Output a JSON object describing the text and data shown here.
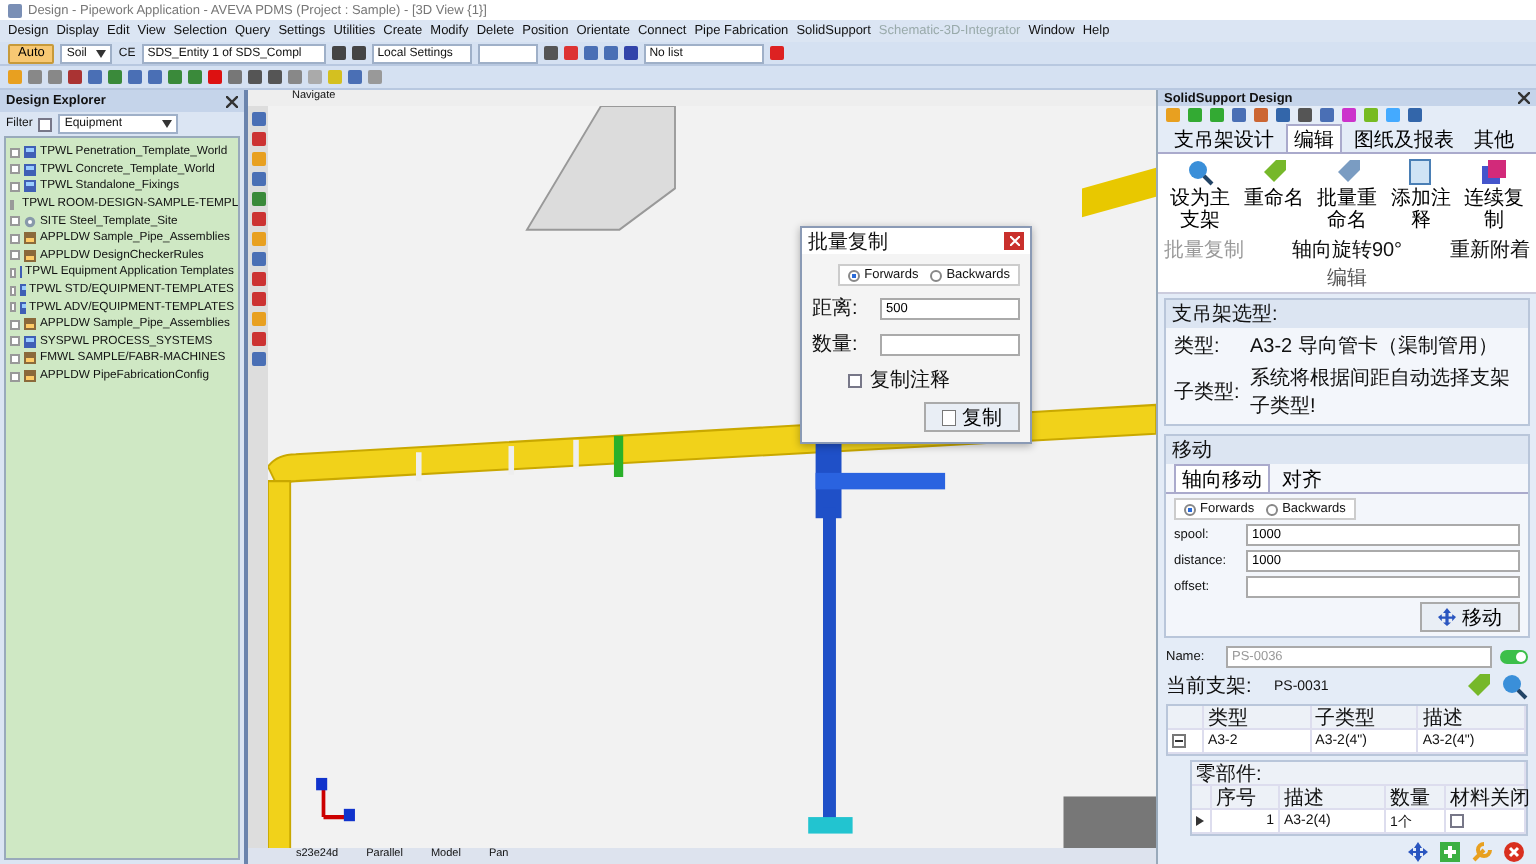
{
  "window": {
    "title": "Design - Pipework Application - AVEVA PDMS (Project : Sample) - [3D View {1}]"
  },
  "menu": [
    {
      "label": "Design",
      "disabled": false
    },
    {
      "label": "Display",
      "disabled": false
    },
    {
      "label": "Edit",
      "disabled": false
    },
    {
      "label": "View",
      "disabled": false
    },
    {
      "label": "Selection",
      "disabled": false
    },
    {
      "label": "Query",
      "disabled": false
    },
    {
      "label": "Settings",
      "disabled": false
    },
    {
      "label": "Utilities",
      "disabled": false
    },
    {
      "label": "Create",
      "disabled": false
    },
    {
      "label": "Modify",
      "disabled": false
    },
    {
      "label": "Delete",
      "disabled": false
    },
    {
      "label": "Position",
      "disabled": false
    },
    {
      "label": "Orientate",
      "disabled": false
    },
    {
      "label": "Connect",
      "disabled": false
    },
    {
      "label": "Pipe Fabrication",
      "disabled": false
    },
    {
      "label": "SolidSupport",
      "disabled": false
    },
    {
      "label": "Schematic-3D-Integrator",
      "disabled": true
    },
    {
      "label": "Window",
      "disabled": false
    },
    {
      "label": "Help",
      "disabled": false
    }
  ],
  "toolbar": {
    "mode_button": "Auto",
    "soil_select": "Soil",
    "ce_label": "CE",
    "element_select": "SDS_Entity 1 of SDS_Compl",
    "settings_select": "Local Settings",
    "list_select": "No list"
  },
  "explorer": {
    "title": "Design Explorer",
    "filter_label": "Filter",
    "filter_checked": false,
    "filter_value": "Equipment",
    "items": [
      {
        "label": "TPWL Penetration_Template_World",
        "kind": "world"
      },
      {
        "label": "TPWL Concrete_Template_World",
        "kind": "world"
      },
      {
        "label": "TPWL Standalone_Fixings",
        "kind": "world"
      },
      {
        "label": "TPWL ROOM-DESIGN-SAMPLE-TEMPL",
        "kind": "world"
      },
      {
        "label": "SITE Steel_Template_Site",
        "kind": "site"
      },
      {
        "label": "APPLDW Sample_Pipe_Assemblies",
        "kind": "app"
      },
      {
        "label": "APPLDW DesignCheckerRules",
        "kind": "app"
      },
      {
        "label": "TPWL Equipment Application Templates",
        "kind": "world"
      },
      {
        "label": "TPWL STD/EQUIPMENT-TEMPLATES",
        "kind": "world"
      },
      {
        "label": "TPWL ADV/EQUIPMENT-TEMPLATES",
        "kind": "world"
      },
      {
        "label": "APPLDW Sample_Pipe_Assemblies",
        "kind": "app"
      },
      {
        "label": "SYSPWL PROCESS_SYSTEMS",
        "kind": "world"
      },
      {
        "label": "FMWL SAMPLE/FABR-MACHINES",
        "kind": "app"
      },
      {
        "label": "APPLDW PipeFabricationConfig",
        "kind": "app"
      }
    ]
  },
  "viewport": {
    "title": "Navigate",
    "status": [
      "s23e24d",
      "Parallel",
      "Model",
      "Pan"
    ]
  },
  "dialog": {
    "title": "批量复制",
    "directions": [
      {
        "label": "Forwards",
        "selected": true
      },
      {
        "label": "Backwards",
        "selected": false
      }
    ],
    "distance_label": "距离:",
    "distance_value": "500",
    "count_label": "数量:",
    "copy_notes": {
      "label": "复制注释",
      "checked": false
    },
    "copy_button": "复制"
  },
  "support_panel": {
    "title": "SolidSupport Design",
    "tabs": [
      {
        "label": "支吊架设计",
        "selected": false
      },
      {
        "label": "编辑",
        "selected": true
      },
      {
        "label": "图纸及报表",
        "selected": false
      },
      {
        "label": "其他",
        "selected": false
      }
    ],
    "ribbon_buttons": [
      {
        "label": "设为主支架",
        "kind": "search"
      },
      {
        "label": "重命名",
        "kind": "tag"
      },
      {
        "label": "批量重命名",
        "kind": "tags"
      },
      {
        "label": "添加注释",
        "kind": "note"
      },
      {
        "label": "连续复制",
        "kind": "copy"
      }
    ],
    "ribbon_small": [
      {
        "label": "批量复制",
        "disabled": true
      },
      {
        "label": "轴向旋转90°",
        "disabled": false
      },
      {
        "label": "重新附着",
        "disabled": false
      }
    ],
    "ribbon_group": "编辑",
    "selection": {
      "title": "支吊架选型:",
      "type_label": "类型:",
      "type_value": "A3-2  导向管卡（渠制管用）",
      "subtype_label": "子类型:",
      "subtype_value": "系统将根据间距自动选择支架子类型!"
    },
    "move": {
      "title": "移动",
      "tabs": [
        {
          "label": "轴向移动",
          "selected": true
        },
        {
          "label": "对齐",
          "selected": false
        }
      ],
      "directions": [
        {
          "label": "Forwards",
          "selected": true
        },
        {
          "label": "Backwards",
          "selected": false
        }
      ],
      "fields": [
        {
          "label": "spool:",
          "value": "1000"
        },
        {
          "label": "distance:",
          "value": "1000"
        },
        {
          "label": "offset:"
        }
      ],
      "button": "移动"
    },
    "name": {
      "label": "Name:",
      "value": "PS-0036",
      "disabled": true,
      "on": true
    },
    "current": {
      "label": "当前支架:",
      "value": "PS-0031"
    },
    "table": {
      "columns": [
        "类型",
        "子类型",
        "描述"
      ],
      "rows": [
        {
          "cells": [
            "A3-2",
            "A3-2(4\")",
            "A3-2(4\")"
          ],
          "expanded": true
        }
      ]
    },
    "parts": {
      "title": "零部件:",
      "columns": [
        "序号",
        "描述",
        "数量",
        "材料关闭"
      ],
      "rows": [
        {
          "cells": [
            "1",
            "A3-2(4)",
            "1个"
          ],
          "checked": false
        }
      ]
    }
  }
}
